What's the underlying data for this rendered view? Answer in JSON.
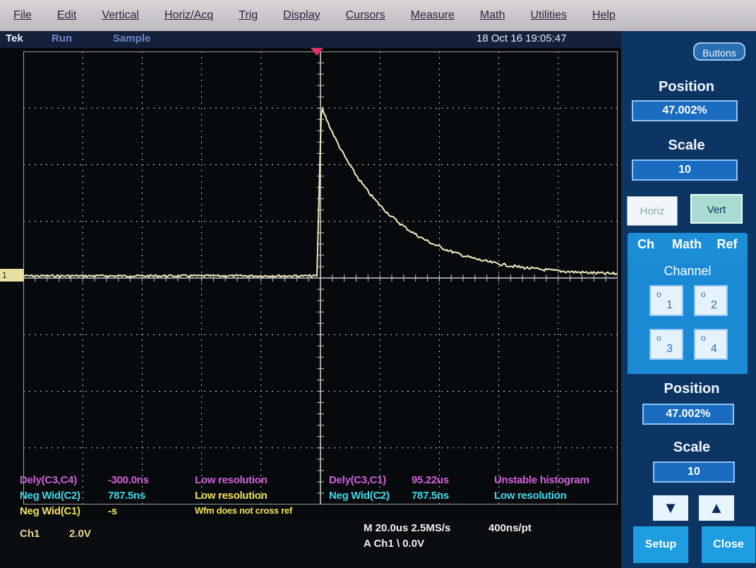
{
  "menu": [
    "File",
    "Edit",
    "Vertical",
    "Horiz/Acq",
    "Trig",
    "Display",
    "Cursors",
    "Measure",
    "Math",
    "Utilities",
    "Help"
  ],
  "status": {
    "brand": "Tek",
    "run": "Run",
    "mode": "Sample",
    "datetime": "18 Oct 16 19:05:47"
  },
  "channel_marker": "1",
  "readouts": {
    "left": [
      {
        "label": "Dely(C3,C4)",
        "value": "-300.0ns",
        "note": "Low resolution",
        "label_color": "#d060d8",
        "value_color": "#d060d8",
        "note_color": "#d060d8"
      },
      {
        "label": "Neg Wid(C2)",
        "value": "787.5ns",
        "note": "Low resolution",
        "label_color": "#40d8e8",
        "value_color": "#40d8e8",
        "note_color": "#f0e060"
      },
      {
        "label": "Neg Wid(C1)",
        "value": "-s",
        "note": "Wfm does not cross ref",
        "label_color": "#f0e060",
        "value_color": "#f0e060",
        "note_color": "#f0e060"
      }
    ],
    "right": [
      {
        "label": "Dely(C3,C1)",
        "value": "95.22us",
        "note": "Unstable histogram",
        "label_color": "#d060d8",
        "value_color": "#d060d8",
        "note_color": "#d060d8"
      },
      {
        "label": "Neg Wid(C2)",
        "value": "787.5ns",
        "note": "Low resolution",
        "label_color": "#40d8e8",
        "value_color": "#40d8e8",
        "note_color": "#40d8e8"
      }
    ]
  },
  "bottom": {
    "ch": "Ch1",
    "volts": "2.0V",
    "timebase": "M 20.0us 2.5MS/s",
    "res": "400ns/pt",
    "trig": "A  Ch1  \\  0.0V"
  },
  "panel": {
    "buttons_label": "Buttons",
    "position_title": "Position",
    "position_value": "47.002%",
    "scale_title": "Scale",
    "scale_value": "10",
    "horiz_label": "Horiz",
    "vert_label": "Vert",
    "tabs": [
      "Ch",
      "Math",
      "Ref"
    ],
    "channel_title": "Channel",
    "channels": [
      "1",
      "2",
      "3",
      "4"
    ],
    "position2_title": "Position",
    "position2_value": "47.002%",
    "scale2_title": "Scale",
    "scale2_value": "10",
    "up_icon": "up-arrow-icon",
    "down_icon": "down-arrow-icon",
    "setup_label": "Setup",
    "close_label": "Close"
  },
  "colors": {
    "trace": "#f2ecc0",
    "grid": "#c9c9c9",
    "trigger_marker": "#e0306a",
    "panel_bg": "#0d3564",
    "panel_accent": "#1c8ed6"
  }
}
